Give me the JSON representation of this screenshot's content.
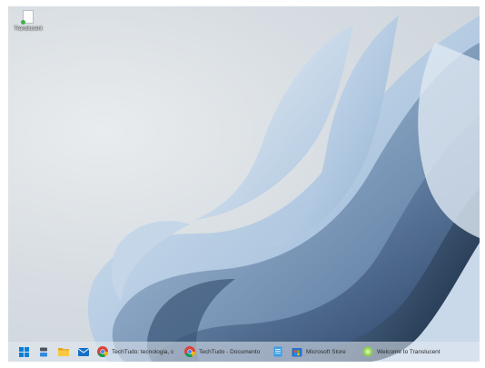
{
  "desktop": {
    "icons": [
      {
        "label": "Translucent",
        "icon": "file-icon"
      }
    ]
  },
  "taskbar": {
    "start": {
      "icon": "windows-start-icon"
    },
    "pinned": [
      {
        "icon": "task-view-icon"
      },
      {
        "icon": "file-explorer-icon"
      },
      {
        "icon": "mail-icon"
      }
    ],
    "apps": [
      {
        "label": "TechTudo: tecnologia, c",
        "icon": "chrome-icon"
      },
      {
        "label": "TechTudo - Documento",
        "icon": "chrome-icon"
      },
      {
        "label": "",
        "icon": "notepad-icon"
      },
      {
        "label": "Microsoft Store",
        "icon": "store-icon"
      },
      {
        "label": "Welcome to Translucent",
        "icon": "translucent-app-icon"
      }
    ]
  },
  "colors": {
    "wallpaper_bg": "#d7dde2",
    "bloom_dark": "#3f5f86",
    "bloom_light": "#c7d8ea",
    "accent": "#0a7fd6"
  }
}
